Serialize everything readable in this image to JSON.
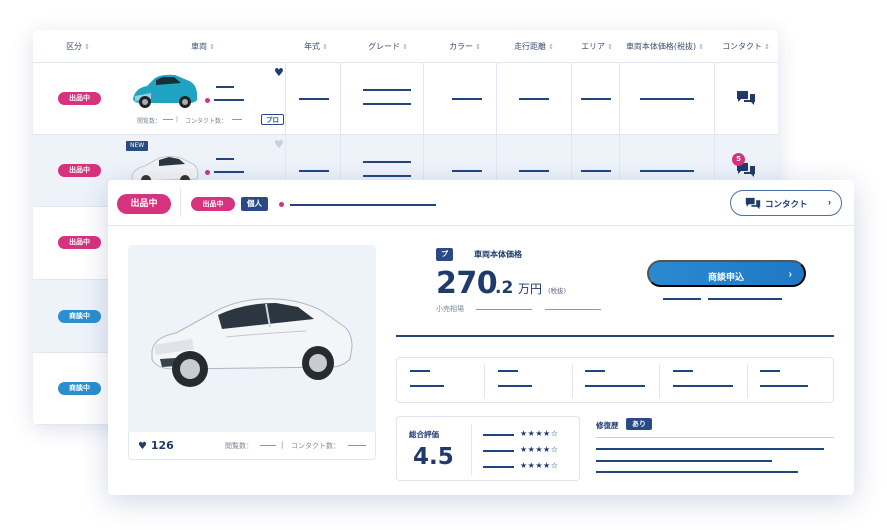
{
  "list": {
    "columns": [
      {
        "label": "区分",
        "sort": "⇕"
      },
      {
        "label": "車両",
        "sort": "⇕"
      },
      {
        "label": "年式",
        "sort": "⇕"
      },
      {
        "label": "グレード",
        "sort": "⇕"
      },
      {
        "label": "カラー",
        "sort": "⇕"
      },
      {
        "label": "走行距離",
        "sort": "⇕"
      },
      {
        "label": "エリア",
        "sort": "⇕"
      },
      {
        "label": "車両本体価格(税抜)",
        "sort": "⇕"
      },
      {
        "label": "コンタクト",
        "sort": "⇕"
      }
    ],
    "rows": [
      {
        "status": "出品中",
        "status_color": "#d6327e",
        "views_label": "閲覧数：",
        "contacts_label": "コンタクト数：",
        "seller_tag": "プロ",
        "favorited": true
      },
      {
        "status": "出品中",
        "status_color": "#d6327e",
        "new_tag": "NEW",
        "contact_count": "5",
        "favorited": false
      },
      {
        "status": "出品中",
        "status_color": "#d6327e"
      },
      {
        "status": "商談中",
        "status_color": "#2a8fd0"
      },
      {
        "status": "商談中",
        "status_color": "#2a8fd0"
      }
    ]
  },
  "detail": {
    "status_large": "出品中",
    "status_small": "出品中",
    "seller_type": "個人",
    "contact_button": "コンタクト",
    "likes": "126",
    "views_label": "閲覧数：",
    "contacts_label": "コンタクト数：",
    "price": {
      "tag": "プロ",
      "label": "車両本体価格",
      "integer": "270",
      "decimal": ".2",
      "unit": "万円",
      "tax_note": "(税抜)",
      "retail_label": "小売相場"
    },
    "deal_button": "商談申込",
    "rating": {
      "title": "総合評価",
      "value": "4.5",
      "stars": [
        "★★★★☆",
        "★★★★☆",
        "★★★★☆"
      ]
    },
    "repair": {
      "title": "修復歴",
      "value": "あり"
    }
  },
  "colors": {
    "accent_pink": "#d6327e",
    "accent_blue": "#2a8fd0",
    "navy": "#1f3a6b"
  },
  "icons": [
    "sort-icon",
    "heart-icon",
    "chat-icon",
    "chevron-right-icon",
    "car-image"
  ]
}
